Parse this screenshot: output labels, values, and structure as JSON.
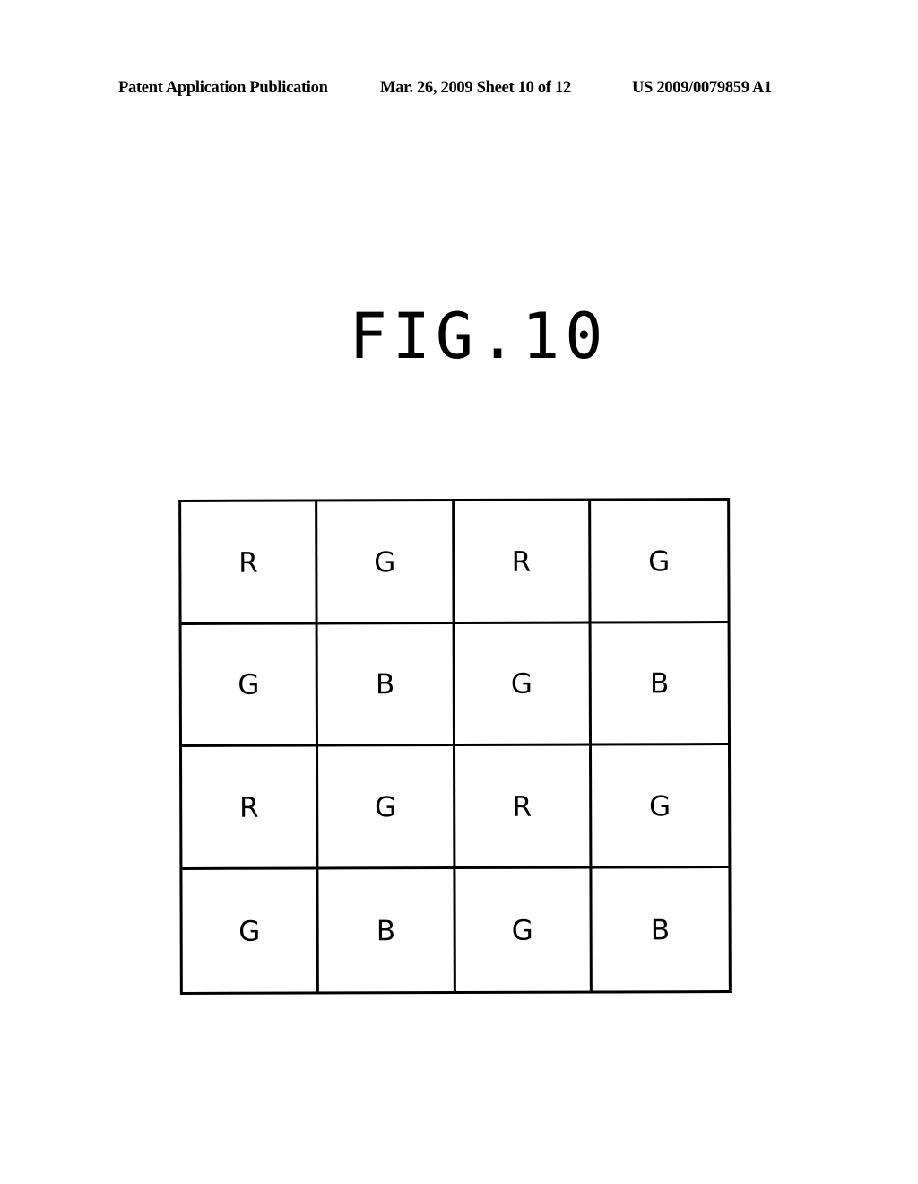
{
  "header": {
    "publication": "Patent Application Publication",
    "date_sheet": "Mar. 26, 2009  Sheet 10 of 12",
    "patent_number": "US 2009/0079859 A1"
  },
  "figure": {
    "title": "FIG.10"
  },
  "grid": {
    "rows": [
      [
        "R",
        "G",
        "R",
        "G"
      ],
      [
        "G",
        "B",
        "G",
        "B"
      ],
      [
        "R",
        "G",
        "R",
        "G"
      ],
      [
        "G",
        "B",
        "G",
        "B"
      ]
    ]
  }
}
